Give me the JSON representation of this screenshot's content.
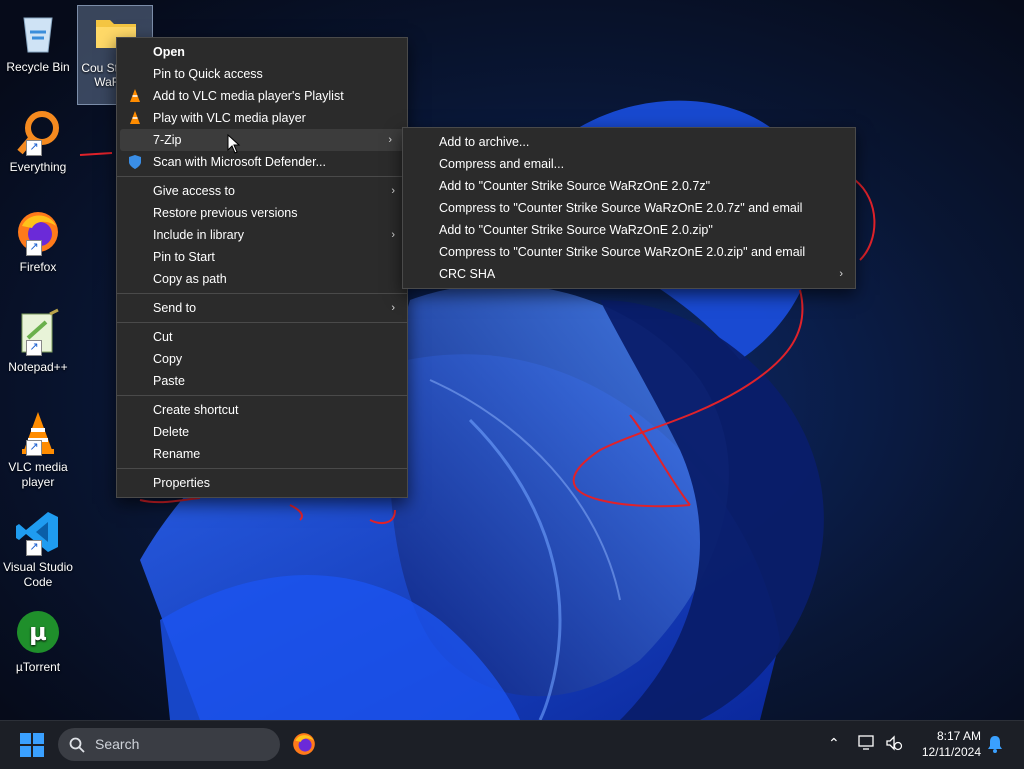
{
  "desktop": {
    "icons": [
      {
        "label": "Recycle Bin",
        "icon": "recycle-bin-icon"
      },
      {
        "label": "Everything",
        "icon": "everything-search-icon"
      },
      {
        "label": "Firefox",
        "icon": "firefox-icon"
      },
      {
        "label": "Notepad++",
        "icon": "notepad-plus-plus-icon"
      },
      {
        "label": "VLC media player",
        "icon": "vlc-icon"
      },
      {
        "label": "Visual Studio Code",
        "icon": "vscode-icon"
      },
      {
        "label": "µTorrent",
        "icon": "utorrent-icon"
      }
    ],
    "selected_file": {
      "label": "Cou Strike S WaRzO",
      "icon": "folder-icon"
    }
  },
  "context_menu": {
    "items": [
      {
        "label": "Open"
      },
      {
        "label": "Pin to Quick access"
      },
      {
        "label": "Add to VLC media player's Playlist",
        "icon": "vlc-icon"
      },
      {
        "label": "Play with VLC media player",
        "icon": "vlc-icon"
      },
      {
        "label": "7-Zip",
        "has_submenu": true
      },
      {
        "label": "Scan with Microsoft Defender...",
        "icon": "defender-shield-icon"
      },
      {
        "label": "Give access to",
        "has_submenu": true
      },
      {
        "label": "Restore previous versions"
      },
      {
        "label": "Include in library",
        "has_submenu": true
      },
      {
        "label": "Pin to Start"
      },
      {
        "label": "Copy as path"
      },
      {
        "label": "Send to",
        "has_submenu": true
      },
      {
        "label": "Cut"
      },
      {
        "label": "Copy"
      },
      {
        "label": "Paste"
      },
      {
        "label": "Create shortcut"
      },
      {
        "label": "Delete"
      },
      {
        "label": "Rename"
      },
      {
        "label": "Properties"
      }
    ]
  },
  "zip_submenu": {
    "items": [
      {
        "label": "Add to archive..."
      },
      {
        "label": "Compress and email..."
      },
      {
        "label": "Add to \"Counter Strike Source WaRzOnE 2.0.7z\""
      },
      {
        "label": "Compress to \"Counter Strike Source WaRzOnE 2.0.7z\" and email"
      },
      {
        "label": "Add to \"Counter Strike Source WaRzOnE 2.0.zip\""
      },
      {
        "label": "Compress to \"Counter Strike Source WaRzOnE 2.0.zip\" and email"
      },
      {
        "label": "CRC SHA",
        "has_submenu": true
      }
    ]
  },
  "taskbar": {
    "search_placeholder": "Search",
    "time": "8:17 AM",
    "date": "12/11/2024"
  },
  "colors": {
    "menu_bg": "#2b2b2b",
    "menu_hover": "#3c3c3c",
    "annotation_red": "#e0222a",
    "taskbar_bg": "#1c1f26"
  }
}
